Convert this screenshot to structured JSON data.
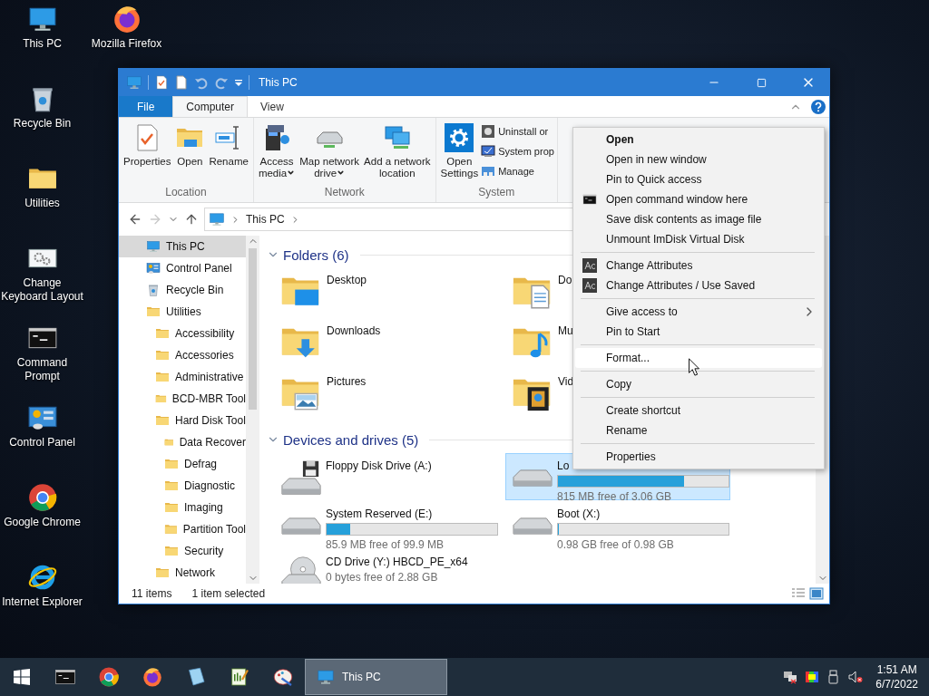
{
  "desktop_icons": [
    {
      "label": "This PC",
      "kind": "pc"
    },
    {
      "label": "Recycle Bin",
      "kind": "recycle"
    },
    {
      "label": "Utilities",
      "kind": "folder"
    },
    {
      "label": "Change Keyboard Layout",
      "kind": "keyboard"
    },
    {
      "label": "Command Prompt",
      "kind": "console"
    },
    {
      "label": "Control Panel",
      "kind": "control"
    },
    {
      "label": "Google Chrome",
      "kind": "chrome"
    },
    {
      "label": "Internet Explorer",
      "kind": "ie"
    },
    {
      "label": "Mozilla Firefox",
      "kind": "firefox"
    }
  ],
  "window": {
    "title": "This PC",
    "tabs": [
      {
        "label": "File",
        "kind": "file",
        "selected": false
      },
      {
        "label": "Computer",
        "kind": "tab",
        "selected": true
      },
      {
        "label": "View",
        "kind": "tab",
        "selected": false
      }
    ],
    "ribbon": {
      "groups": [
        {
          "label": "Location",
          "buttons": [
            {
              "lines": [
                "Properties"
              ],
              "kind": "properties",
              "dropdown": false
            },
            {
              "lines": [
                "Open"
              ],
              "kind": "open",
              "dropdown": false
            },
            {
              "lines": [
                "Rename"
              ],
              "kind": "rename",
              "dropdown": false
            }
          ]
        },
        {
          "label": "Network",
          "buttons": [
            {
              "lines": [
                "Access",
                "media"
              ],
              "kind": "media",
              "dropdown": true
            },
            {
              "lines": [
                "Map network",
                "drive"
              ],
              "kind": "netdrive",
              "dropdown": true
            },
            {
              "lines": [
                "Add a network",
                "location"
              ],
              "kind": "netloc",
              "dropdown": false
            }
          ]
        },
        {
          "label": "System",
          "buttons": [
            {
              "lines": [
                "Open",
                "Settings"
              ],
              "kind": "settings",
              "dropdown": false
            }
          ],
          "small_buttons": [
            {
              "label": "Uninstall or",
              "kind": "uninstall"
            },
            {
              "label": "System prop",
              "kind": "sysprop"
            },
            {
              "label": "Manage",
              "kind": "manage"
            }
          ]
        }
      ]
    },
    "address": {
      "path": [
        "This PC"
      ]
    },
    "nav": [
      {
        "label": "This PC",
        "kind": "pc",
        "selected": true
      },
      {
        "label": "Control Panel",
        "kind": "control",
        "selected": false
      },
      {
        "label": "Recycle Bin",
        "kind": "recycle",
        "selected": false
      },
      {
        "label": "Utilities",
        "kind": "folder",
        "selected": false,
        "children": [
          {
            "label": "Accessibility",
            "kind": "folder",
            "selected": false
          },
          {
            "label": "Accessories",
            "kind": "folder",
            "selected": false
          },
          {
            "label": "Administrative",
            "kind": "folder",
            "selected": false
          },
          {
            "label": "BCD-MBR Tool",
            "kind": "folder",
            "selected": false
          },
          {
            "label": "Hard Disk Tool",
            "kind": "folder",
            "selected": false,
            "children": [
              {
                "label": "Data Recover",
                "kind": "folder",
                "selected": false
              },
              {
                "label": "Defrag",
                "kind": "folder",
                "selected": false
              },
              {
                "label": "Diagnostic",
                "kind": "folder",
                "selected": false
              },
              {
                "label": "Imaging",
                "kind": "folder",
                "selected": false
              },
              {
                "label": "Partition Tool",
                "kind": "folder",
                "selected": false
              },
              {
                "label": "Security",
                "kind": "folder",
                "selected": false
              }
            ]
          },
          {
            "label": "Network",
            "kind": "folder",
            "selected": false
          }
        ]
      }
    ],
    "sections": [
      {
        "title": "Folders (6)",
        "kind": "folders",
        "items": [
          {
            "label": "Desktop",
            "kind": "desktop",
            "selected": false
          },
          {
            "label": "Do",
            "kind": "documents",
            "selected": false
          },
          {
            "label": "Downloads",
            "kind": "downloads",
            "selected": false
          },
          {
            "label": "Mu",
            "kind": "music",
            "selected": false
          },
          {
            "label": "Pictures",
            "kind": "pictures",
            "selected": false
          },
          {
            "label": "Vid",
            "kind": "videos",
            "selected": false
          }
        ]
      },
      {
        "title": "Devices and drives (5)",
        "kind": "drives",
        "items": [
          {
            "label": "Floppy Disk Drive (A:)",
            "kind": "floppy",
            "selected": false
          },
          {
            "label": "Lo",
            "kind": "disk",
            "selected": true,
            "level": 0.74,
            "free": "815 MB free of 3.06 GB"
          },
          {
            "label": "System Reserved (E:)",
            "kind": "disk",
            "selected": false,
            "level": 0.14,
            "free": "85.9 MB free of 99.9 MB"
          },
          {
            "label": "Boot (X:)",
            "kind": "disk",
            "selected": false,
            "level": 0.0,
            "free": "0.98 GB free of 0.98 GB"
          },
          {
            "label": "CD Drive (Y:) HBCD_PE_x64",
            "kind": "cd",
            "selected": false,
            "free": "0 bytes free of 2.88 GB"
          }
        ]
      }
    ],
    "status": {
      "count": "11 items",
      "selection": "1 item selected"
    }
  },
  "context_menu": {
    "items": [
      {
        "kind": "item",
        "label": "Open",
        "bold": true,
        "submenu": false,
        "selected": false
      },
      {
        "kind": "item",
        "label": "Open in new window",
        "bold": false,
        "submenu": false,
        "selected": false
      },
      {
        "kind": "item",
        "label": "Pin to Quick access",
        "bold": false,
        "submenu": false,
        "selected": false
      },
      {
        "kind": "console_item",
        "label": "Open command window here",
        "bold": false,
        "submenu": false,
        "selected": false
      },
      {
        "kind": "item",
        "label": "Save disk contents as image file",
        "bold": false,
        "submenu": false,
        "selected": false
      },
      {
        "kind": "item",
        "label": "Unmount ImDisk Virtual Disk",
        "bold": false,
        "submenu": false,
        "selected": false
      },
      {
        "kind": "separator"
      },
      {
        "kind": "attrib_item",
        "label": "Change Attributes",
        "bold": false,
        "submenu": false,
        "selected": false
      },
      {
        "kind": "attrib_item",
        "label": "Change Attributes / Use Saved",
        "bold": false,
        "submenu": false,
        "selected": false
      },
      {
        "kind": "separator"
      },
      {
        "kind": "item",
        "label": "Give access to",
        "bold": false,
        "submenu": true,
        "selected": false
      },
      {
        "kind": "item",
        "label": "Pin to Start",
        "bold": false,
        "submenu": false,
        "selected": false
      },
      {
        "kind": "separator"
      },
      {
        "kind": "item",
        "label": "Format...",
        "bold": false,
        "submenu": false,
        "selected": true
      },
      {
        "kind": "separator"
      },
      {
        "kind": "item",
        "label": "Copy",
        "bold": false,
        "submenu": false,
        "selected": false
      },
      {
        "kind": "separator"
      },
      {
        "kind": "item",
        "label": "Create shortcut",
        "bold": false,
        "submenu": false,
        "selected": false
      },
      {
        "kind": "item",
        "label": "Rename",
        "bold": false,
        "submenu": false,
        "selected": false
      },
      {
        "kind": "separator"
      },
      {
        "kind": "item",
        "label": "Properties",
        "bold": false,
        "submenu": false,
        "selected": false
      }
    ]
  },
  "taskbar": {
    "tasks": [
      {
        "label": "This PC",
        "selected": true
      }
    ],
    "clock": {
      "time": "1:51 AM",
      "date": "6/7/2022"
    }
  }
}
